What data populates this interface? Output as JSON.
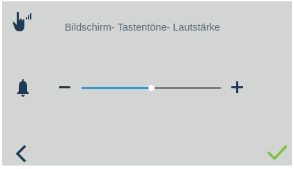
{
  "header": {
    "icon": "hand-touch-signal-icon",
    "title": "Bildschirm- Tastentöne- Lautstärke"
  },
  "volume": {
    "icon": "bell-icon",
    "decrease_icon": "minus-icon",
    "increase_icon": "plus-icon",
    "level_fraction": 0.5,
    "fill_color": "#2f97d6"
  },
  "footer": {
    "back_icon": "chevron-left-icon",
    "confirm_icon": "checkmark-icon",
    "confirm_color": "#7dc142"
  }
}
